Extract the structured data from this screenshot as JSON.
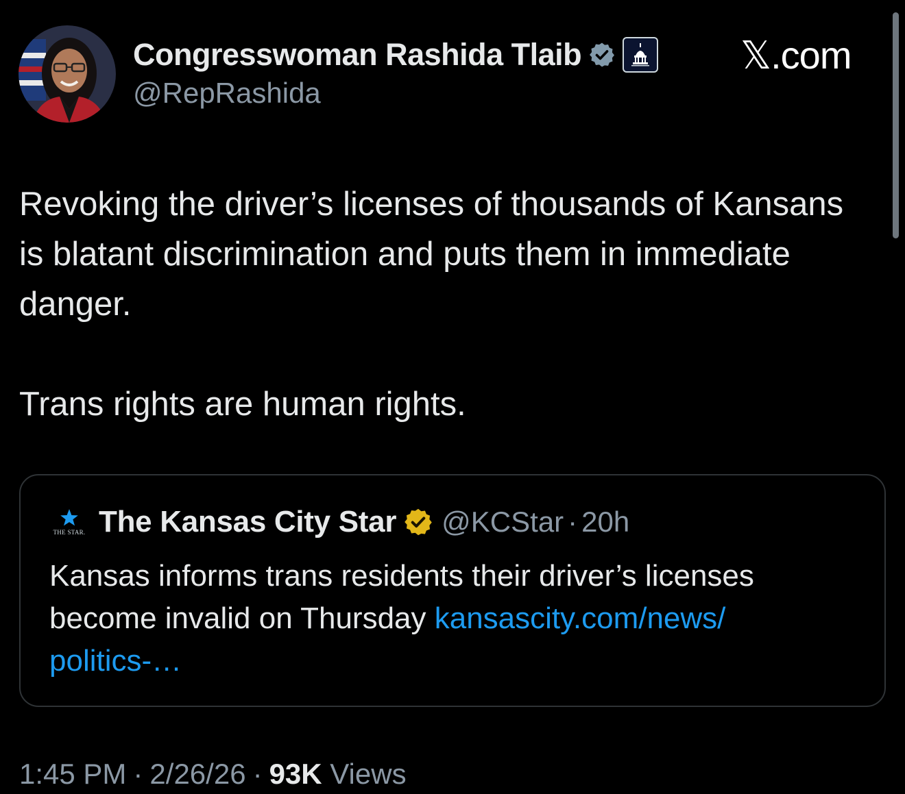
{
  "author": {
    "display_name": "Congresswoman Rashida Tlaib",
    "handle": "@RepRashida",
    "avatar_icon": "avatar-photo",
    "verified_color": "#829aab"
  },
  "brand": {
    "site": "𝕏.com"
  },
  "post": {
    "paragraphs": [
      "Revoking the driver’s licenses of thousands of Kansans is blatant discrimination and puts them in immediate danger.",
      "Trans rights are human rights."
    ]
  },
  "quote": {
    "logo_text": "THE STAR.",
    "name": "The Kansas City Star",
    "handle": "@KCStar",
    "separator": "·",
    "time": "20h",
    "text": "Kansas informs trans residents their driver’s licenses become invalid on Thursday ",
    "link_text": "kansascity.com/news/ politics-…",
    "verified_color": "#e2b719",
    "link_color": "#1d9bf0"
  },
  "meta": {
    "time": "1:45 PM",
    "date": "2/26/26",
    "views_count": "93K",
    "views_label": "Views",
    "separator": "·"
  },
  "colors": {
    "background": "#000000",
    "text": "#e7e9ea",
    "secondary": "#8b98a5",
    "border": "#2f3336"
  }
}
